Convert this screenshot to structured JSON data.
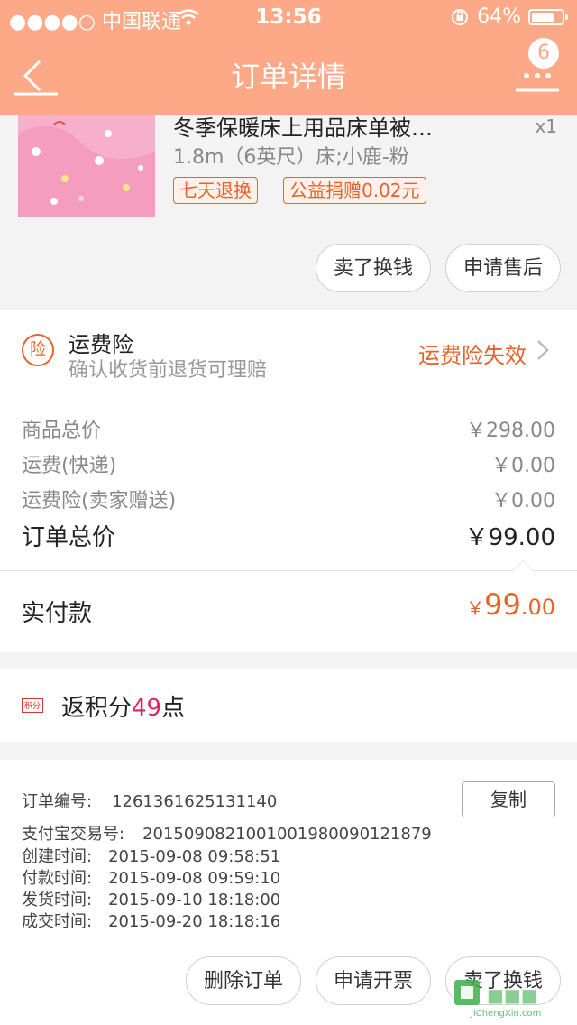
{
  "status_bar": {
    "carrier": "●●●●○ 中国联通",
    "time": "13:56",
    "battery": "64%"
  },
  "nav": {
    "title": "订单详情",
    "badge": "6"
  },
  "product": {
    "title": "冬季保暖床上用品床单被…",
    "qty": "x1",
    "spec": "1.8m（6英尺）床;小鹿-粉",
    "tags": [
      "七天退换",
      "公益捐赠0.02元"
    ],
    "buttons": [
      "卖了换钱",
      "申请售后"
    ]
  },
  "insurance": {
    "icon_text": "险",
    "title": "运费险",
    "subtitle": "确认收货前退货可理赔",
    "status": "运费险失效"
  },
  "prices": {
    "rows": [
      {
        "label": "商品总价",
        "value": "￥298.00"
      },
      {
        "label": "运费(快递)",
        "value": "￥0.00"
      },
      {
        "label": "运费险(卖家赠送)",
        "value": "￥0.00"
      }
    ],
    "total_label": "订单总价",
    "total_value": "￥99.00"
  },
  "paid": {
    "label": "实付款",
    "currency": "￥",
    "integer": "99",
    "decimal": ".00"
  },
  "points": {
    "icon_text": "积分",
    "prefix": "返积分",
    "number": "49",
    "suffix": "点"
  },
  "order_info": {
    "copy_label": "复制",
    "rows": [
      {
        "key": "订单编号:",
        "value": "1261361625131140"
      },
      {
        "key": "支付宝交易号:",
        "value": "2015090821001001980090121879"
      },
      {
        "key": "创建时间:",
        "value": "2015-09-08 09:58:51"
      },
      {
        "key": "付款时间:",
        "value": "2015-09-08 09:59:10"
      },
      {
        "key": "发货时间:",
        "value": "2015-09-10 18:18:00"
      },
      {
        "key": "成交时间:",
        "value": "2015-09-20 18:18:16"
      }
    ]
  },
  "footer": {
    "buttons": [
      "删除订单",
      "申请开票",
      "卖了换钱"
    ]
  },
  "watermark": {
    "text": "JiChengXin.com"
  },
  "colors": {
    "header": "#fda887",
    "accent": "#e8622a",
    "points": "#e0245e"
  }
}
